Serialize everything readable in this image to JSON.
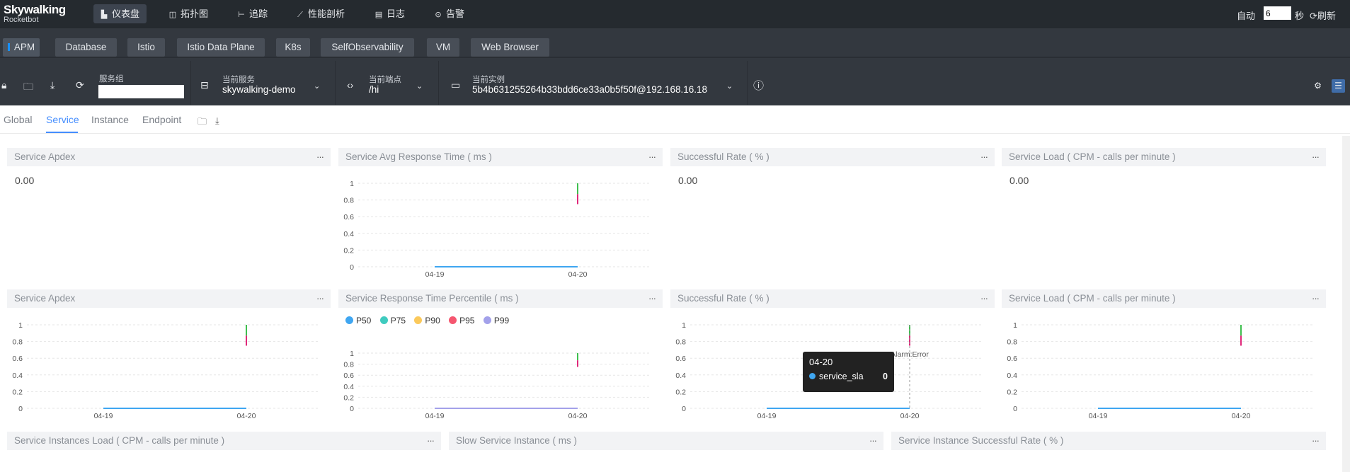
{
  "app": {
    "name_line1": "Skywalking",
    "name_line2": "Rocketbot"
  },
  "nav": {
    "items": [
      {
        "icon": "▙",
        "label": "仪表盘"
      },
      {
        "icon": "◫",
        "label": "拓扑图"
      },
      {
        "icon": "⊢",
        "label": "追踪"
      },
      {
        "icon": "⟋",
        "label": "性能剖析"
      },
      {
        "icon": "▤",
        "label": "日志"
      },
      {
        "icon": "⊙",
        "label": "告警"
      }
    ],
    "auto_label": "自动",
    "auto_value": "6",
    "seconds_label": "秒",
    "refresh_label": "刷新"
  },
  "layers": [
    "APM",
    "Database",
    "Istio",
    "Istio Data Plane",
    "K8s",
    "SelfObservability",
    "VM",
    "Web Browser"
  ],
  "selectors": {
    "group_label": "服务组",
    "group_value": "",
    "service_label": "当前服务",
    "service_value": "skywalking-demo",
    "endpoint_label": "当前端点",
    "endpoint_value": "/hi",
    "instance_label": "当前实例",
    "instance_value": "5b4b631255264b33bdd6ce33a0b5f50f@192.168.16.18"
  },
  "dashboard_tabs": [
    "Global",
    "Service",
    "Instance",
    "Endpoint"
  ],
  "panels": {
    "row1": [
      {
        "title": "Service Apdex",
        "value": "0.00"
      },
      {
        "title": "Service Avg Response Time ( ms )"
      },
      {
        "title": "Successful Rate ( % )",
        "value": "0.00"
      },
      {
        "title": "Service Load ( CPM - calls per minute )",
        "value": "0.00"
      }
    ],
    "row2": [
      {
        "title": "Service Apdex"
      },
      {
        "title": "Service Response Time Percentile ( ms )"
      },
      {
        "title": "Successful Rate ( % )"
      },
      {
        "title": "Service Load ( CPM - calls per minute )"
      }
    ],
    "row3": [
      {
        "title": "Service Instances Load ( CPM - calls per minute )"
      },
      {
        "title": "Slow Service Instance ( ms )"
      },
      {
        "title": "Service Instance Successful Rate ( % )"
      }
    ],
    "menu_glyph": "···"
  },
  "chart_common": {
    "y_ticks": [
      "1",
      "0.8",
      "0.6",
      "0.4",
      "0.2",
      "0"
    ],
    "x_ticks": [
      "04-19",
      "04-20"
    ]
  },
  "percentile_legend": [
    {
      "name": "P50",
      "color": "#3fa6f1"
    },
    {
      "name": "P75",
      "color": "#3fcbbf"
    },
    {
      "name": "P90",
      "color": "#fbc95b"
    },
    {
      "name": "P95",
      "color": "#f5566f"
    },
    {
      "name": "P99",
      "color": "#a3a1ea"
    }
  ],
  "markline_label": "Alarm:Error",
  "tooltip": {
    "date": "04-20",
    "series": "service_sla",
    "value": "0"
  },
  "chart_data": [
    {
      "type": "line",
      "panel": "Service Avg Response Time ( ms )",
      "categories": [
        "04-19",
        "04-20"
      ],
      "series": [
        {
          "values": [
            0,
            0
          ]
        }
      ],
      "ylim": [
        0,
        1
      ]
    },
    {
      "type": "line",
      "panel": "Service Apdex",
      "categories": [
        "04-19",
        "04-20"
      ],
      "series": [
        {
          "values": [
            0,
            0
          ]
        }
      ],
      "ylim": [
        0,
        1
      ]
    },
    {
      "type": "line",
      "panel": "Service Response Time Percentile ( ms )",
      "categories": [
        "04-19",
        "04-20"
      ],
      "series": [
        {
          "name": "P50",
          "values": [
            0,
            0
          ]
        },
        {
          "name": "P75",
          "values": [
            0,
            0
          ]
        },
        {
          "name": "P90",
          "values": [
            0,
            0
          ]
        },
        {
          "name": "P95",
          "values": [
            0,
            0
          ]
        },
        {
          "name": "P99",
          "values": [
            0,
            0
          ]
        }
      ],
      "ylim": [
        0,
        1
      ]
    },
    {
      "type": "line",
      "panel": "Successful Rate ( % )",
      "categories": [
        "04-19",
        "04-20"
      ],
      "series": [
        {
          "name": "service_sla",
          "values": [
            0,
            0
          ]
        }
      ],
      "ylim": [
        0,
        1
      ]
    },
    {
      "type": "line",
      "panel": "Service Load ( CPM - calls per minute )",
      "categories": [
        "04-19",
        "04-20"
      ],
      "series": [
        {
          "values": [
            0,
            0
          ]
        }
      ],
      "ylim": [
        0,
        1
      ]
    }
  ]
}
